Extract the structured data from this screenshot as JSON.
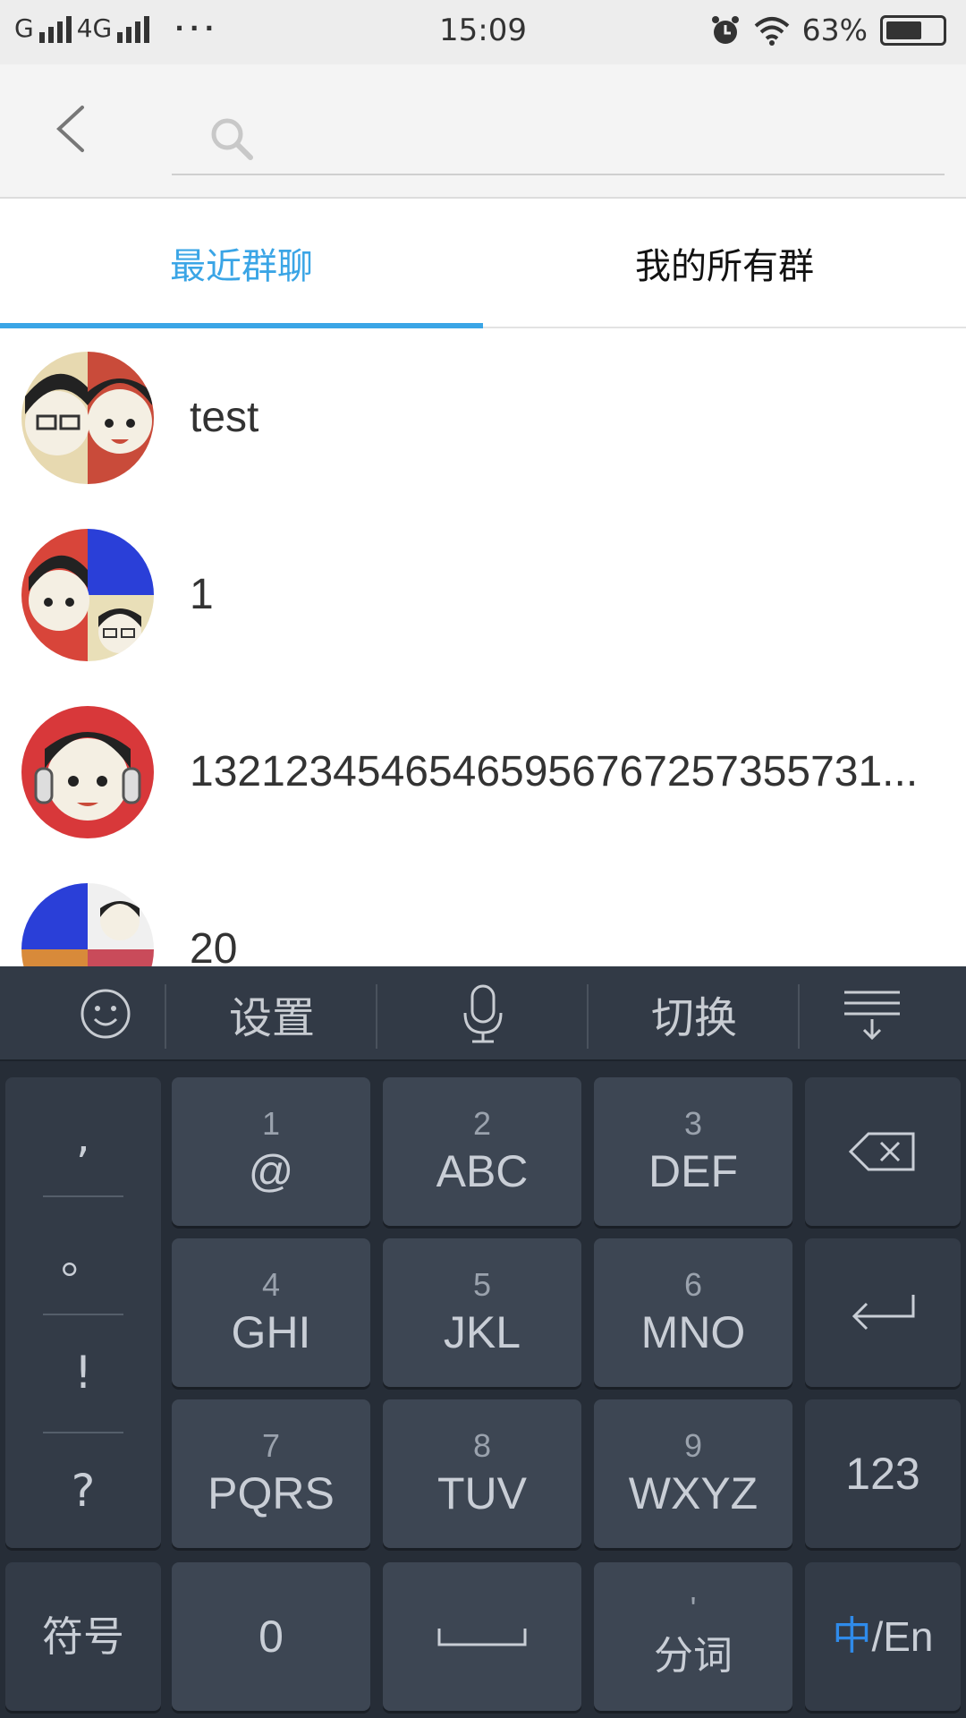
{
  "status_bar": {
    "carrier1": "G",
    "carrier2": "4G",
    "dots": "···",
    "time": "15:09",
    "battery": "63%",
    "battery_level": 0.63
  },
  "search": {
    "placeholder": "",
    "value": ""
  },
  "tabs": [
    {
      "label": "最近群聊",
      "active": true
    },
    {
      "label": "我的所有群",
      "active": false
    }
  ],
  "groups": [
    {
      "name": "test"
    },
    {
      "name": "1"
    },
    {
      "name": "13212345465465956767257355731..."
    },
    {
      "name": "20"
    }
  ],
  "keyboard": {
    "toolbar": {
      "emoji": "emoji-icon",
      "settings": "设置",
      "voice": "microphone-icon",
      "switch": "切换",
      "hide": "hide-keyboard-icon"
    },
    "punctuation": [
      ",",
      "。",
      "!",
      "?"
    ],
    "keys": [
      {
        "num": "1",
        "letters": "@"
      },
      {
        "num": "2",
        "letters": "ABC"
      },
      {
        "num": "3",
        "letters": "DEF"
      },
      {
        "num": "4",
        "letters": "GHI"
      },
      {
        "num": "5",
        "letters": "JKL"
      },
      {
        "num": "6",
        "letters": "MNO"
      },
      {
        "num": "7",
        "letters": "PQRS"
      },
      {
        "num": "8",
        "letters": "TUV"
      },
      {
        "num": "9",
        "letters": "WXYZ"
      }
    ],
    "numeric_key": "123",
    "symbols_key": "符号",
    "zero_key": "0",
    "split_key_top": "'",
    "split_key": "分词",
    "lang_zh": "中",
    "lang_en": "/En"
  },
  "colors": {
    "accent": "#3aa5e6",
    "keyboard_bg": "#262d37",
    "key_bg": "#3d4653",
    "lang_highlight": "#2f8bea"
  }
}
